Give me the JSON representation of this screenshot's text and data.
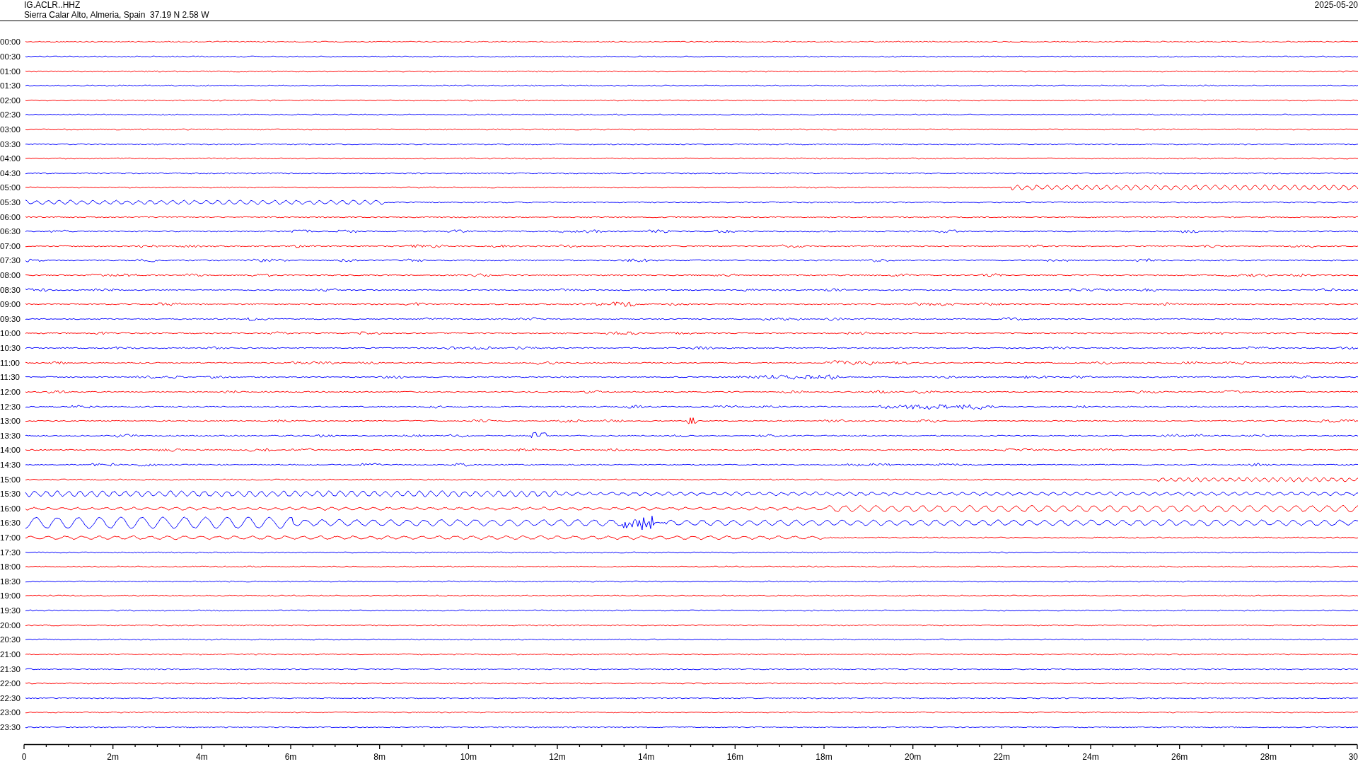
{
  "header": {
    "station": "IG.ACLR..HHZ",
    "location": "Sierra Calar Alto, Almeria, Spain  37.19 N 2.58 W",
    "date": "2025-05-20"
  },
  "rows": [
    {
      "time": "00:00",
      "color": "#ff0000"
    },
    {
      "time": "00:30",
      "color": "#0000ff"
    },
    {
      "time": "01:00",
      "color": "#ff0000"
    },
    {
      "time": "01:30",
      "color": "#0000ff"
    },
    {
      "time": "02:00",
      "color": "#ff0000"
    },
    {
      "time": "02:30",
      "color": "#0000ff"
    },
    {
      "time": "03:00",
      "color": "#ff0000"
    },
    {
      "time": "03:30",
      "color": "#0000ff"
    },
    {
      "time": "04:00",
      "color": "#ff0000"
    },
    {
      "time": "04:30",
      "color": "#0000ff"
    },
    {
      "time": "05:00",
      "color": "#ff0000"
    },
    {
      "time": "05:30",
      "color": "#0000ff"
    },
    {
      "time": "06:00",
      "color": "#ff0000"
    },
    {
      "time": "06:30",
      "color": "#0000ff"
    },
    {
      "time": "07:00",
      "color": "#ff0000"
    },
    {
      "time": "07:30",
      "color": "#0000ff"
    },
    {
      "time": "08:00",
      "color": "#ff0000"
    },
    {
      "time": "08:30",
      "color": "#0000ff"
    },
    {
      "time": "09:00",
      "color": "#ff0000"
    },
    {
      "time": "09:30",
      "color": "#0000ff"
    },
    {
      "time": "10:00",
      "color": "#ff0000"
    },
    {
      "time": "10:30",
      "color": "#0000ff"
    },
    {
      "time": "11:00",
      "color": "#ff0000"
    },
    {
      "time": "11:30",
      "color": "#0000ff"
    },
    {
      "time": "12:00",
      "color": "#ff0000"
    },
    {
      "time": "12:30",
      "color": "#0000ff"
    },
    {
      "time": "13:00",
      "color": "#ff0000"
    },
    {
      "time": "13:30",
      "color": "#0000ff"
    },
    {
      "time": "14:00",
      "color": "#ff0000"
    },
    {
      "time": "14:30",
      "color": "#0000ff"
    },
    {
      "time": "15:00",
      "color": "#ff0000"
    },
    {
      "time": "15:30",
      "color": "#0000ff"
    },
    {
      "time": "16:00",
      "color": "#ff0000"
    },
    {
      "time": "16:30",
      "color": "#0000ff"
    },
    {
      "time": "17:00",
      "color": "#ff0000"
    },
    {
      "time": "17:30",
      "color": "#0000ff"
    },
    {
      "time": "18:00",
      "color": "#ff0000"
    },
    {
      "time": "18:30",
      "color": "#0000ff"
    },
    {
      "time": "19:00",
      "color": "#ff0000"
    },
    {
      "time": "19:30",
      "color": "#0000ff"
    },
    {
      "time": "20:00",
      "color": "#ff0000"
    },
    {
      "time": "20:30",
      "color": "#0000ff"
    },
    {
      "time": "21:00",
      "color": "#ff0000"
    },
    {
      "time": "21:30",
      "color": "#0000ff"
    },
    {
      "time": "22:00",
      "color": "#ff0000"
    },
    {
      "time": "22:30",
      "color": "#0000ff"
    },
    {
      "time": "23:00",
      "color": "#ff0000"
    },
    {
      "time": "23:30",
      "color": "#0000ff"
    }
  ],
  "axis": {
    "labels": [
      "0",
      "2m",
      "4m",
      "6m",
      "8m",
      "10m",
      "12m",
      "14m",
      "16m",
      "18m",
      "20m",
      "22m",
      "24m",
      "26m",
      "28m",
      "30"
    ]
  }
}
